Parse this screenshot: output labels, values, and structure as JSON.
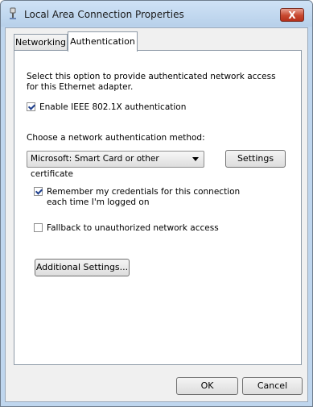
{
  "window": {
    "title": "Local Area Connection Properties",
    "close_label": "X"
  },
  "tabs": [
    {
      "label": "Networking"
    },
    {
      "label": "Authentication"
    }
  ],
  "auth": {
    "description": "Select this option to provide authenticated network access for this Ethernet adapter.",
    "enable_label": "Enable IEEE 802.1X authentication",
    "enable_checked": true,
    "choose_method_label": "Choose a network authentication method:",
    "method_selected": "Microsoft: Smart Card or other certificate",
    "settings_label": "Settings",
    "remember_label": "Remember my credentials for this connection each time I'm logged on",
    "remember_checked": true,
    "fallback_label": "Fallback to unauthorized network access",
    "fallback_checked": false,
    "additional_settings_label": "Additional Settings..."
  },
  "footer": {
    "ok_label": "OK",
    "cancel_label": "Cancel"
  }
}
